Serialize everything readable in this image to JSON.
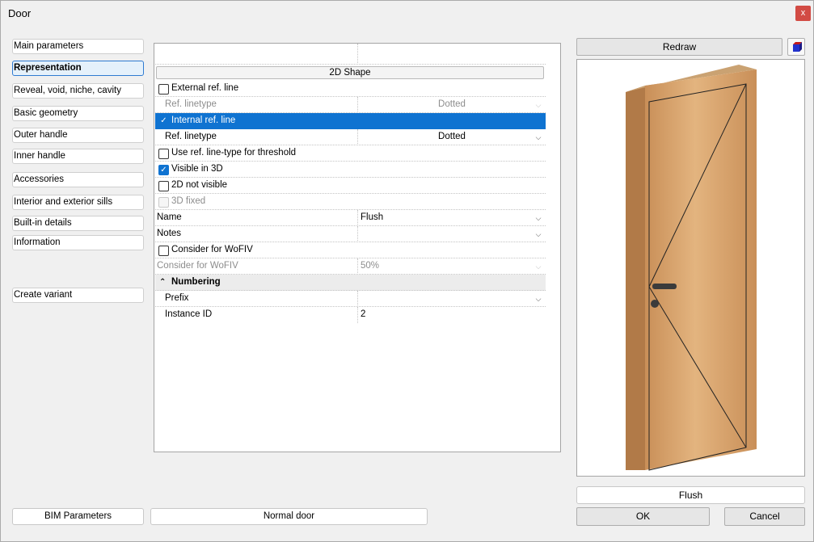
{
  "window": {
    "title": "Door",
    "close_label": "x"
  },
  "nav": {
    "items": [
      {
        "label": "Main parameters",
        "active": false
      },
      {
        "label": "Representation",
        "active": true
      },
      {
        "label": "Reveal, void, niche, cavity",
        "active": false
      },
      {
        "label": "Basic geometry",
        "active": false
      },
      {
        "label": "Outer handle",
        "active": false
      },
      {
        "label": "Inner handle",
        "active": false
      },
      {
        "label": "Accessories",
        "active": false
      },
      {
        "label": "Interior and exterior sills",
        "active": false
      },
      {
        "label": "Built-in details",
        "active": false
      },
      {
        "label": "Information",
        "active": false
      }
    ],
    "create_variant": "Create variant",
    "bim_parameters": "BIM Parameters"
  },
  "properties": {
    "section_button": "2D Shape",
    "rows": [
      {
        "label": "External ref. line",
        "checkbox": "unchecked"
      },
      {
        "label": "Ref. linetype",
        "value": "Dotted",
        "disabled": true,
        "dropdown": true
      },
      {
        "label": "Internal ref. line",
        "checkbox": "checked",
        "selected": true
      },
      {
        "label": "Ref. linetype",
        "value": "Dotted",
        "dropdown": true
      },
      {
        "label": "Use ref. line-type for threshold",
        "checkbox": "unchecked"
      },
      {
        "label": "Visible in 3D",
        "checkbox": "checked"
      },
      {
        "label": "2D not visible",
        "checkbox": "unchecked"
      },
      {
        "label": "3D fixed",
        "checkbox": "disabled",
        "disabled": true
      },
      {
        "label": "Name",
        "value": "Flush",
        "dropdown": true
      },
      {
        "label": "Notes",
        "value": "",
        "dropdown": true
      },
      {
        "label": "Consider for WoFIV",
        "checkbox": "unchecked"
      },
      {
        "label": "Consider for WoFIV",
        "value": "50%",
        "disabled": true,
        "dropdown": true
      },
      {
        "label": "Numbering",
        "group": true
      },
      {
        "label": "Prefix",
        "value": "",
        "dropdown": true
      },
      {
        "label": "Instance ID",
        "value": "2"
      }
    ]
  },
  "footer": {
    "door_type": "Normal door",
    "ok": "OK",
    "cancel": "Cancel"
  },
  "preview": {
    "redraw": "Redraw",
    "name": "Flush",
    "door_color": "#d9a46a",
    "cube_icon": "cube-view-icon"
  }
}
